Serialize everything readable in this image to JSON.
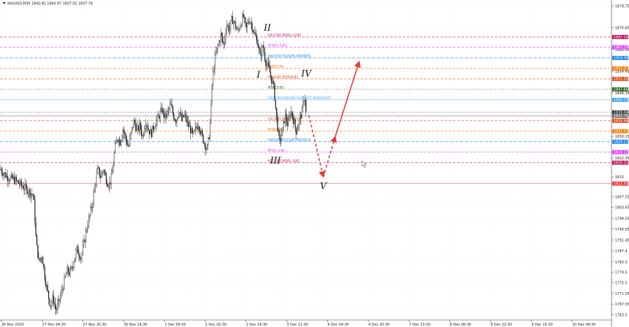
{
  "header": {
    "symbol_info": "XAUUSD,M30  1840.92 1840.97 1837.02 1837.74"
  },
  "chart_data": {
    "type": "candlestick",
    "symbol": "XAUUSD",
    "timeframe": "M30",
    "ohlc": {
      "open": 1840.92,
      "high": 1840.97,
      "low": 1837.02,
      "close": 1837.74
    },
    "ylim": [
      1761.6,
      1881.0
    ],
    "y_ticks": [
      1878.75,
      1870.65,
      1862.55,
      1854.45,
      1846.35,
      1838.25,
      1830.15,
      1822.05,
      1815.0,
      1807.55,
      1803.65,
      1799.55,
      1795.55,
      1791.45,
      1787.4,
      1783.3,
      1779.5,
      1775.5,
      1771.55,
      1767.55,
      1763.5
    ],
    "x_ticks": [
      "26 Nov 2020",
      "27 Nov 04:30",
      "27 Nov 20:30",
      "30 Nov 16:30",
      "1 Dec 09:30",
      "2 Dec 02:30",
      "2 Dec 18:30",
      "3 Dec 11:30",
      "4 Dec 04:30",
      "4 Dec 20:30",
      "7 Dec 13:30",
      "8 Dec 06:30",
      "8 Dec 22:30",
      "9 Dec 15:30",
      "10 Dec 08:30"
    ],
    "price_path": [
      [
        0,
        1818
      ],
      [
        10,
        1815
      ],
      [
        20,
        1814
      ],
      [
        30,
        1812
      ],
      [
        40,
        1810
      ],
      [
        48,
        1808
      ],
      [
        52,
        1790
      ],
      [
        56,
        1783
      ],
      [
        60,
        1786
      ],
      [
        64,
        1778
      ],
      [
        68,
        1772
      ],
      [
        72,
        1767
      ],
      [
        76,
        1770
      ],
      [
        80,
        1765
      ],
      [
        84,
        1768
      ],
      [
        88,
        1772
      ],
      [
        92,
        1776
      ],
      [
        96,
        1780
      ],
      [
        100,
        1779
      ],
      [
        104,
        1782
      ],
      [
        110,
        1788
      ],
      [
        116,
        1785
      ],
      [
        120,
        1790
      ],
      [
        124,
        1796
      ],
      [
        128,
        1800
      ],
      [
        132,
        1805
      ],
      [
        136,
        1812
      ],
      [
        140,
        1818
      ],
      [
        144,
        1815
      ],
      [
        148,
        1818
      ],
      [
        152,
        1814
      ],
      [
        156,
        1812
      ],
      [
        160,
        1815
      ],
      [
        164,
        1825
      ],
      [
        168,
        1830
      ],
      [
        172,
        1828
      ],
      [
        176,
        1833
      ],
      [
        180,
        1829
      ],
      [
        184,
        1826
      ],
      [
        188,
        1832
      ],
      [
        192,
        1836
      ],
      [
        196,
        1832
      ],
      [
        200,
        1834
      ],
      [
        204,
        1830
      ],
      [
        208,
        1836
      ],
      [
        212,
        1833
      ],
      [
        216,
        1831
      ],
      [
        220,
        1834
      ],
      [
        224,
        1836
      ],
      [
        228,
        1838
      ],
      [
        232,
        1840
      ],
      [
        236,
        1837
      ],
      [
        240,
        1839
      ],
      [
        244,
        1842
      ],
      [
        248,
        1838
      ],
      [
        252,
        1836
      ],
      [
        256,
        1840
      ],
      [
        260,
        1836
      ],
      [
        264,
        1838
      ],
      [
        268,
        1835
      ],
      [
        272,
        1833
      ],
      [
        276,
        1830
      ],
      [
        280,
        1833
      ],
      [
        284,
        1835
      ],
      [
        288,
        1831
      ],
      [
        292,
        1828
      ],
      [
        296,
        1825
      ],
      [
        300,
        1832
      ],
      [
        304,
        1852
      ],
      [
        308,
        1860
      ],
      [
        312,
        1864
      ],
      [
        316,
        1868
      ],
      [
        320,
        1864
      ],
      [
        324,
        1872
      ],
      [
        328,
        1870
      ],
      [
        332,
        1874
      ],
      [
        336,
        1872
      ],
      [
        340,
        1869
      ],
      [
        344,
        1872
      ],
      [
        348,
        1875
      ],
      [
        352,
        1870
      ],
      [
        356,
        1874
      ],
      [
        360,
        1872
      ],
      [
        364,
        1868
      ],
      [
        368,
        1866
      ],
      [
        372,
        1860
      ],
      [
        376,
        1864
      ],
      [
        380,
        1858
      ],
      [
        384,
        1856
      ],
      [
        388,
        1852
      ],
      [
        392,
        1848
      ],
      [
        396,
        1836
      ],
      [
        400,
        1828
      ],
      [
        404,
        1832
      ],
      [
        408,
        1838
      ],
      [
        412,
        1834
      ],
      [
        416,
        1840
      ],
      [
        420,
        1836
      ],
      [
        424,
        1832
      ],
      [
        428,
        1836
      ],
      [
        432,
        1839
      ],
      [
        436,
        1846
      ],
      [
        438,
        1838
      ]
    ],
    "levels": [
      {
        "label": "H1[7/8] M30[+2/8]",
        "price": 1867.19,
        "color": "#c2185b",
        "dash": "4,2"
      },
      {
        "label": "M30[+1/8]",
        "price": 1863.35,
        "color": "#e040fb",
        "dash": "4,2"
      },
      {
        "label": "H4[7/8] H1[6/8] M30RES",
        "price": 1859.38,
        "color": "#1e88e5",
        "dash": "5,2"
      },
      {
        "label": "M30[7/8]",
        "price": 1855.47,
        "color": "#f57c00",
        "dash": "4,2"
      },
      {
        "label": "H1[5/8] M30[6/8]",
        "price": 1851.56,
        "color": "#e64a19",
        "dash": "4,2"
      },
      {
        "label": "M30[5/8]",
        "price": 1847.66,
        "color": "#33691e",
        "dash": "2,2"
      },
      {
        "label": "D1[3/8] H4[6/8] H1PIVOT M30PIVOT",
        "price": 1843.75,
        "color": "#42a5f5",
        "dash": ""
      },
      {
        "label": "",
        "price": 1839.06,
        "color": "#333333",
        "dash": "2,2"
      },
      {
        "label": "",
        "price": 1837.74,
        "color": "#777777",
        "dash": ""
      },
      {
        "label": "H1[3/8] M30[2/8]",
        "price": 1835.94,
        "color": "#e64a19",
        "dash": "4,2"
      },
      {
        "label": "M30[1/8]",
        "price": 1832.03,
        "color": "#f57c00",
        "dash": "4,2"
      },
      {
        "label": "H4[5/8] H1[2/8] M30SUP",
        "price": 1828.12,
        "color": "#1e88e5",
        "dash": "5,2"
      },
      {
        "label": "M30[-1/8]",
        "price": 1824.22,
        "color": "#e040fb",
        "dash": "4,2"
      },
      {
        "label": "H1[1/8] M30[-2/8]",
        "price": 1820.31,
        "color": "#c2185b",
        "dash": "4,2"
      },
      {
        "label": "",
        "price": 1812.5,
        "color": "#e53935",
        "dash": ""
      }
    ],
    "price_tags": [
      {
        "text": "1867.19",
        "price": 1867.19,
        "color": "#c2185b"
      },
      {
        "text": "1863.35",
        "price": 1863.35,
        "color": "#e040fb"
      },
      {
        "text": "1859.38",
        "price": 1859.38,
        "color": "#1e88e5"
      },
      {
        "text": "1855.47",
        "price": 1855.47,
        "color": "#f57c00"
      },
      {
        "text": "1851.56",
        "price": 1851.56,
        "color": "#e64a19"
      },
      {
        "text": "1847.66",
        "price": 1847.66,
        "color": "#33691e"
      },
      {
        "text": "1843.75",
        "price": 1843.75,
        "color": "#42a5f5"
      },
      {
        "text": "1839.06",
        "price": 1839.06,
        "color": "#333333"
      },
      {
        "text": "1837.74",
        "price": 1837.74,
        "color": "#777777"
      },
      {
        "text": "1835.94",
        "price": 1835.94,
        "color": "#e64a19"
      },
      {
        "text": "1832.03",
        "price": 1832.03,
        "color": "#f57c00"
      },
      {
        "text": "1828.12",
        "price": 1828.12,
        "color": "#1e88e5"
      },
      {
        "text": "1824.22",
        "price": 1824.22,
        "color": "#e040fb"
      },
      {
        "text": "1820.31",
        "price": 1820.31,
        "color": "#c2185b"
      },
      {
        "text": "1812.50",
        "price": 1812.5,
        "color": "#e53935"
      }
    ],
    "wave_labels": [
      {
        "text": "II",
        "x_frac": 0.425,
        "price": 1869.5
      },
      {
        "text": "I",
        "x_frac": 0.411,
        "price": 1852.0
      },
      {
        "text": "IV",
        "x_frac": 0.487,
        "price": 1852.5
      },
      {
        "text": "III",
        "x_frac": 0.438,
        "price": 1820.0
      },
      {
        "text": "V",
        "x_frac": 0.514,
        "price": 1810.5
      }
    ],
    "projection": [
      {
        "from": [
          1838.0,
          0.491
        ],
        "to": [
          1815.0,
          0.514
        ],
        "style": "dashed"
      },
      {
        "from": [
          1815.0,
          0.514
        ],
        "to": [
          1830.0,
          0.533
        ],
        "style": "dashed"
      },
      {
        "from": [
          1830.0,
          0.533
        ],
        "to": [
          1858.0,
          0.571
        ],
        "style": "solid"
      }
    ],
    "colors": {
      "candles": "#111111",
      "grid": "#e5e5e5",
      "projection": "#e53935"
    }
  }
}
